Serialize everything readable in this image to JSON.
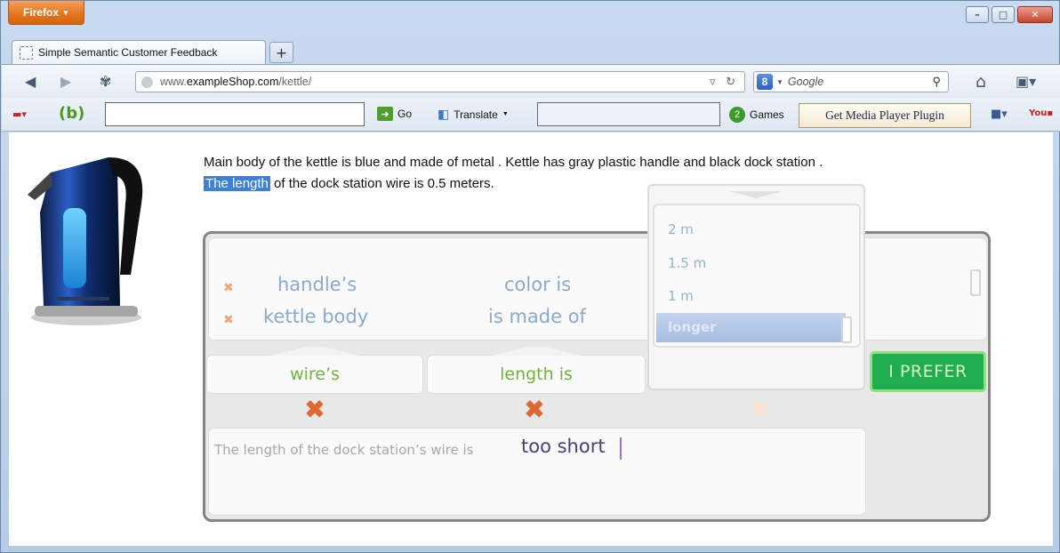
{
  "browser": {
    "menu_label": "Firefox",
    "tab_title": "Simple Semantic Customer Feedback",
    "new_tab_label": "+",
    "url_prefix": "www.",
    "url_domain": "exampleShop.com",
    "url_path": "/kettle/",
    "search_placeholder": "Google",
    "window_controls": {
      "minimize": "–",
      "maximize": "□",
      "close": "✕"
    }
  },
  "addon_toolbar": {
    "go_label": "Go",
    "translate_label": "Translate",
    "games_label": "Games",
    "media_plugin_label": "Get Media Player Plugin"
  },
  "page": {
    "desc_line1": "Main body of the kettle is blue and made of metal . Kettle has gray plastic handle and black dock station .",
    "desc_highlight": "The length",
    "desc_line2_rest": " of the dock station wire is 0.5 meters."
  },
  "widget": {
    "chips_col1": [
      "handle’s",
      "kettle body"
    ],
    "chips_col2": [
      "color is",
      "is made of"
    ],
    "slot1": "wire’s",
    "slot2": "length is",
    "prefer_button": "I PREFER",
    "composer_prefix": "The length of the dock station’s wire is",
    "composer_value": "too short",
    "dropdown_options": [
      "2 m",
      "1.5 m",
      "1 m",
      "longer"
    ],
    "dropdown_selected": "longer"
  },
  "icons": {
    "remove_small": "✖",
    "remove_large": "✖",
    "back": "◀",
    "forward": "▶",
    "home": "⌂",
    "search": "⚲",
    "reload": "↻"
  },
  "colors": {
    "accent_green": "#20ad4f",
    "chip_blue": "#8aa9cf",
    "slot_green": "#72b33a",
    "remove_orange": "#e2652b",
    "highlight_blue": "#3d7fd9"
  }
}
